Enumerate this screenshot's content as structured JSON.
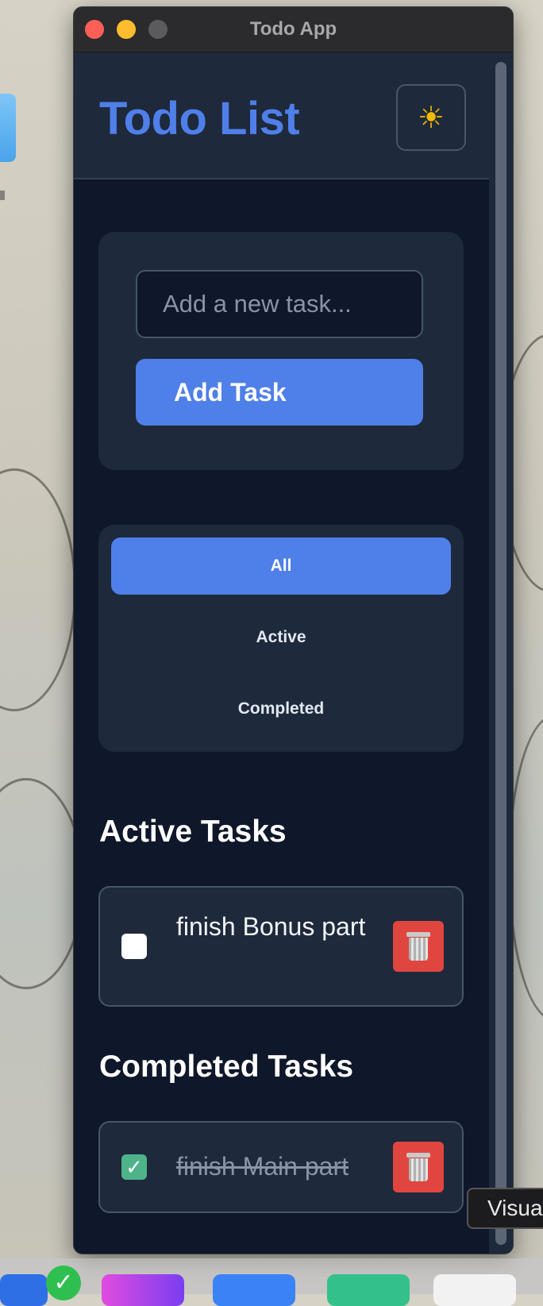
{
  "window": {
    "title": "Todo App"
  },
  "header": {
    "title": "Todo List",
    "theme_icon": "sun-icon"
  },
  "add_task": {
    "placeholder": "Add a new task...",
    "value": "",
    "button_label": "Add Task"
  },
  "filters": [
    {
      "label": "All",
      "active": true
    },
    {
      "label": "Active",
      "active": false
    },
    {
      "label": "Completed",
      "active": false
    }
  ],
  "sections": {
    "active_title": "Active Tasks",
    "completed_title": "Completed Tasks"
  },
  "active_tasks": [
    {
      "text": "finish Bonus part",
      "completed": false
    }
  ],
  "completed_tasks": [
    {
      "text": "finish Main part",
      "completed": true
    }
  ],
  "tooltip": {
    "text": "Visua"
  },
  "colors": {
    "accent": "#4f7fe9",
    "background": "#0f172a",
    "card": "#1e293b",
    "delete": "#e0463f",
    "checkbox_checked": "#4fb38a"
  }
}
